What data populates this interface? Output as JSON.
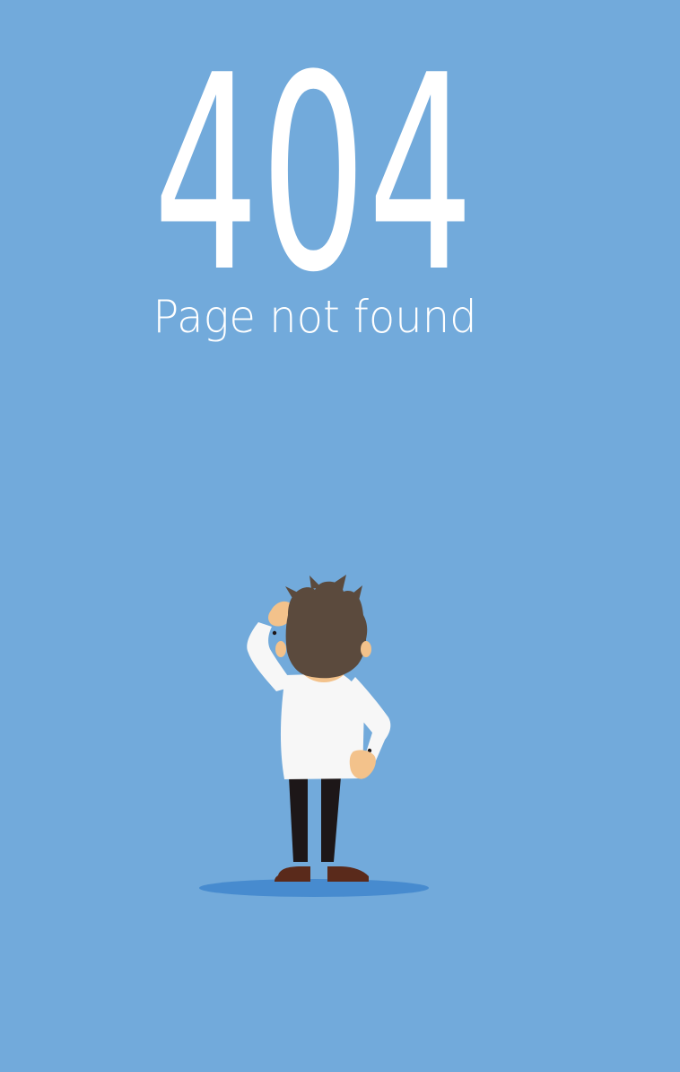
{
  "error": {
    "code": "404",
    "message": "Page not found"
  },
  "illustration": {
    "icon": "confused-person-illustration",
    "colors": {
      "background": "#72aadb",
      "shadow": "#3f86cc",
      "hair": "#5b4a3d",
      "skin": "#f3c28b",
      "shirt": "#f7f7f7",
      "pants": "#1d1718",
      "shoes": "#5a2a1b"
    }
  }
}
